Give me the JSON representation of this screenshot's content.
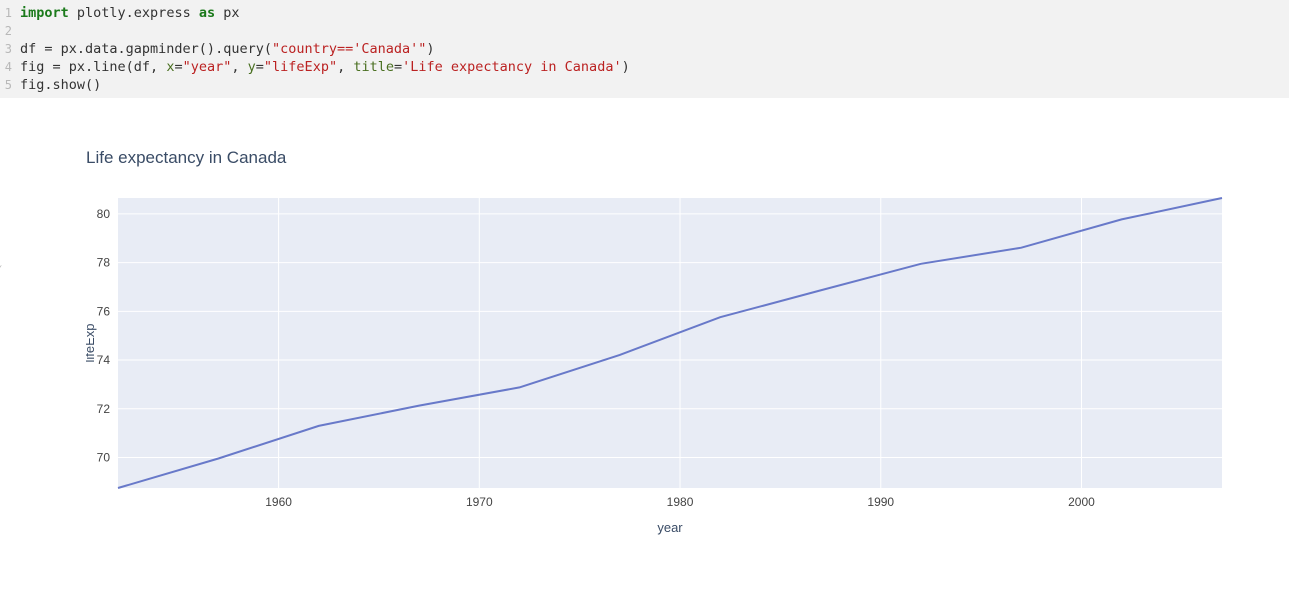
{
  "code": {
    "lines": [
      {
        "n": "1",
        "tokens": [
          {
            "t": "import",
            "c": "kw"
          },
          {
            "t": " plotly.express ",
            "c": ""
          },
          {
            "t": "as",
            "c": "kw"
          },
          {
            "t": " px",
            "c": ""
          }
        ]
      },
      {
        "n": "2",
        "tokens": [
          {
            "t": "",
            "c": ""
          }
        ]
      },
      {
        "n": "3",
        "tokens": [
          {
            "t": "df = px.data.gapminder().query(",
            "c": ""
          },
          {
            "t": "\"country=='Canada'\"",
            "c": "str"
          },
          {
            "t": ")",
            "c": ""
          }
        ]
      },
      {
        "n": "4",
        "tokens": [
          {
            "t": "fig = px.line(df, ",
            "c": ""
          },
          {
            "t": "x",
            "c": "param"
          },
          {
            "t": "=",
            "c": ""
          },
          {
            "t": "\"year\"",
            "c": "str"
          },
          {
            "t": ", ",
            "c": ""
          },
          {
            "t": "y",
            "c": "param"
          },
          {
            "t": "=",
            "c": ""
          },
          {
            "t": "\"lifeExp\"",
            "c": "str"
          },
          {
            "t": ", ",
            "c": ""
          },
          {
            "t": "title",
            "c": "param"
          },
          {
            "t": "=",
            "c": ""
          },
          {
            "t": "'Life expectancy in Canada'",
            "c": "str"
          },
          {
            "t": ")",
            "c": ""
          }
        ]
      },
      {
        "n": "5",
        "tokens": [
          {
            "t": "fig.show()",
            "c": ""
          }
        ]
      }
    ]
  },
  "fold_caret": "ˇ",
  "chart_data": {
    "type": "line",
    "title": "Life expectancy in Canada",
    "xlabel": "year",
    "ylabel": "lifeExp",
    "x": [
      1952,
      1957,
      1962,
      1967,
      1972,
      1977,
      1982,
      1987,
      1992,
      1997,
      2002,
      2007
    ],
    "y": [
      68.75,
      69.96,
      71.3,
      72.13,
      72.88,
      74.21,
      75.76,
      76.86,
      77.95,
      78.61,
      79.77,
      80.65
    ],
    "x_ticks": [
      1960,
      1970,
      1980,
      1990,
      2000
    ],
    "y_ticks": [
      70,
      72,
      74,
      76,
      78,
      80
    ],
    "xlim": [
      1952,
      2007
    ],
    "ylim": [
      68.75,
      80.65
    ],
    "line_color": "#6879c9",
    "bg_color": "#e8ecf5"
  }
}
